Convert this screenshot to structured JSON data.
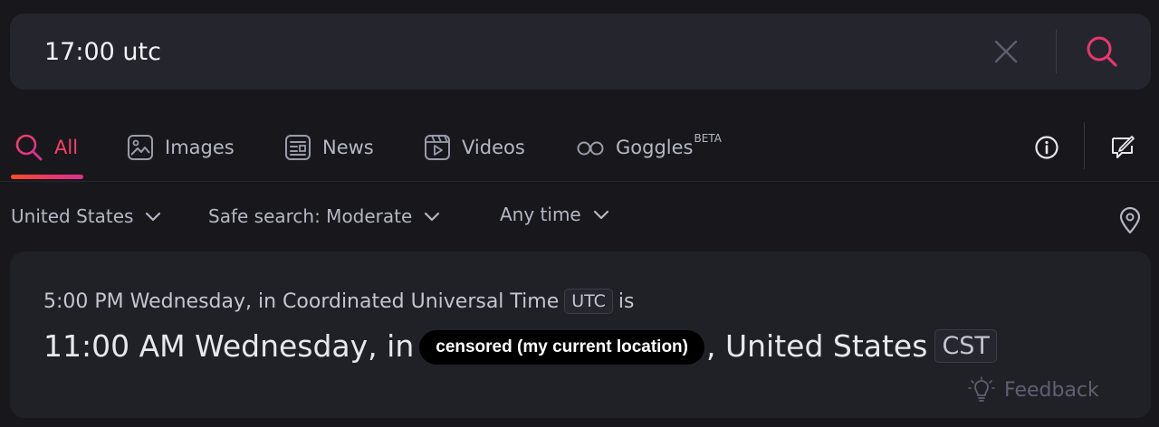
{
  "search": {
    "query": "17:00 utc",
    "clear_icon": "close-icon",
    "submit_icon": "search-icon"
  },
  "tabs": [
    {
      "label": "All",
      "icon": "search-icon",
      "active": true
    },
    {
      "label": "Images",
      "icon": "image-icon"
    },
    {
      "label": "News",
      "icon": "newspaper-icon"
    },
    {
      "label": "Videos",
      "icon": "video-icon"
    },
    {
      "label": "Goggles",
      "icon": "goggles-icon",
      "badge": "BETA"
    }
  ],
  "toolbar": {
    "info_icon": "info-icon",
    "feedback_icon": "feedback-icon"
  },
  "filters": {
    "region": "United States",
    "safe_search": "Safe search: Moderate",
    "time": "Any time",
    "location_icon": "location-pin-icon"
  },
  "result": {
    "line1_prefix": "5:00 PM Wednesday, in Coordinated Universal Time",
    "line1_badge": "UTC",
    "line1_suffix": "is",
    "line2_prefix": "11:00 AM Wednesday, in",
    "censored_text": "censored (my current location)",
    "line2_suffix": ", United States",
    "line2_badge": "CST",
    "feedback_label": "Feedback",
    "feedback_icon": "lightbulb-icon"
  },
  "colors": {
    "accent": "#f7406a",
    "background": "#18181c",
    "surface": "#25262d"
  }
}
